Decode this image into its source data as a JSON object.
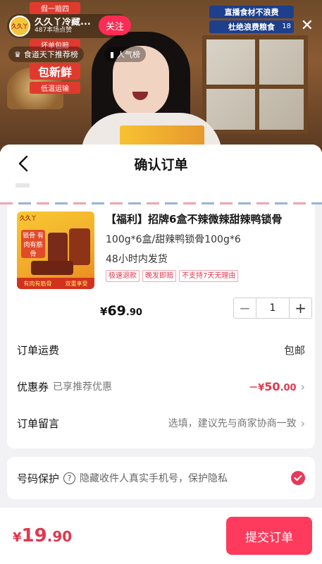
{
  "live": {
    "host_name": "久久丫冷藏...",
    "host_likes": "487本场点赞",
    "avatar_text": "久久丫",
    "follow_label": "关注",
    "promo_chips": [
      "假一赔四",
      "坏单包赔"
    ],
    "promo_big": "包新鲜",
    "promo_small": "低温运输",
    "banner_lines": [
      "直播食材不浪费",
      "杜绝浪费粮食"
    ],
    "viewer_count": "18",
    "rank_pill": "食道天下推荐榜",
    "popularity_pill": "人气榜",
    "close_icon": "close-icon"
  },
  "sheet": {
    "title": "确认订单",
    "back_icon": "chevron-left-icon"
  },
  "product": {
    "thumb_brand": "久久丫",
    "thumb_badge": "锁骨 有肉有筋骨",
    "thumb_strip": [
      "有肉有筋骨",
      "双重享受"
    ],
    "title": "【福利】招牌6盒不辣微辣甜辣鸭锁骨",
    "spec": "100g*6盒/甜辣鸭锁骨100g*6",
    "ship": "48小时内发货",
    "tags": [
      "极速退款",
      "晚发即赔",
      "不支持7天无理由"
    ],
    "price_currency": "¥",
    "price_int": "69",
    "price_dec": ".90",
    "quantity": "1",
    "minus": "−",
    "plus": "+"
  },
  "rows": {
    "shipping_label": "订单运费",
    "shipping_value": "包邮",
    "coupon_label": "优惠券",
    "coupon_sub": "已享推荐优惠",
    "coupon_sign": "－¥",
    "coupon_int": "50",
    "coupon_dec": ".00",
    "note_label": "订单留言",
    "note_placeholder": "选填，建议先与商家协商一致"
  },
  "privacy": {
    "label": "号码保护",
    "help": "?",
    "text": "隐藏收件人真实手机号，保护隐私",
    "checked": true
  },
  "footer": {
    "total_currency": "¥",
    "total_int": "19",
    "total_dec": ".90",
    "submit_label": "提交订单"
  },
  "colors": {
    "accent": "#fe2c55",
    "price_red": "#e0384f",
    "submit": "#fe3b5c"
  }
}
